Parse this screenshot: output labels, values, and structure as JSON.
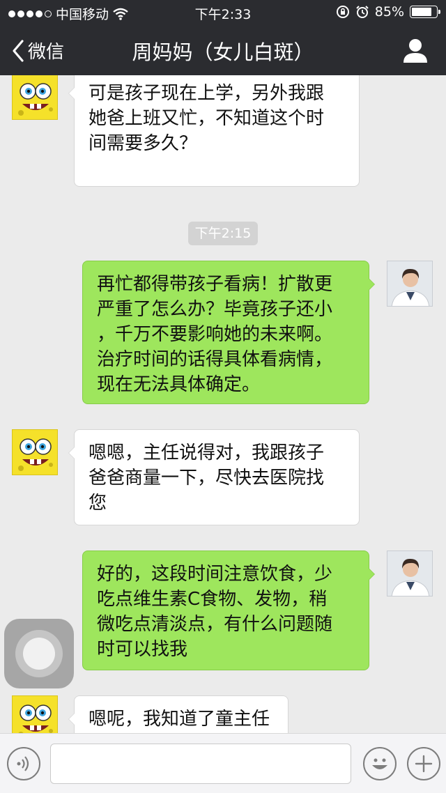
{
  "status_bar": {
    "carrier": "中国移动",
    "time": "下午2:33",
    "battery_text": "85%",
    "battery_level": 0.85
  },
  "nav": {
    "back_label": "微信",
    "title": "周妈妈（女儿白斑）"
  },
  "messages": [
    {
      "side": "in",
      "avatar": "spongebob-avatar",
      "text_lines": [
        "可是孩子现在上学，另外我跟",
        "她爸上班又忙，不知道这个时",
        "间需要多久？"
      ]
    },
    {
      "timestamp": "下午2:15"
    },
    {
      "side": "out",
      "avatar": "doctor-avatar",
      "text_lines": [
        "再忙都得带孩子看病！扩散更",
        "严重了怎么办？毕竟孩子还小",
        "，千万不要影响她的未来啊。",
        "治疗时间的话得具体看病情，",
        "现在无法具体确定。"
      ]
    },
    {
      "side": "in",
      "avatar": "spongebob-avatar",
      "text_lines": [
        "嗯嗯，主任说得对，我跟孩子",
        "爸爸商量一下，尽快去医院找",
        "您"
      ]
    },
    {
      "side": "out",
      "avatar": "doctor-avatar",
      "text_lines": [
        "好的，这段时间注意饮食，少",
        "吃点维生素C食物、发物，稍",
        "微吃点清淡点，有什么问题随",
        "时可以找我"
      ]
    },
    {
      "side": "in",
      "avatar": "spongebob-avatar",
      "text_lines": [
        "嗯呢，我知道了童主任"
      ]
    }
  ],
  "colors": {
    "header_bg": "#2b2c30",
    "chat_bg": "#ebebeb",
    "bubble_out": "#9ee65d",
    "bubble_in": "#ffffff"
  },
  "icons": [
    "back-chevron-icon",
    "profile-icon",
    "voice-icon",
    "emoji-icon",
    "plus-icon",
    "wifi-icon",
    "lock-rotation-icon",
    "alarm-icon",
    "battery-icon"
  ]
}
